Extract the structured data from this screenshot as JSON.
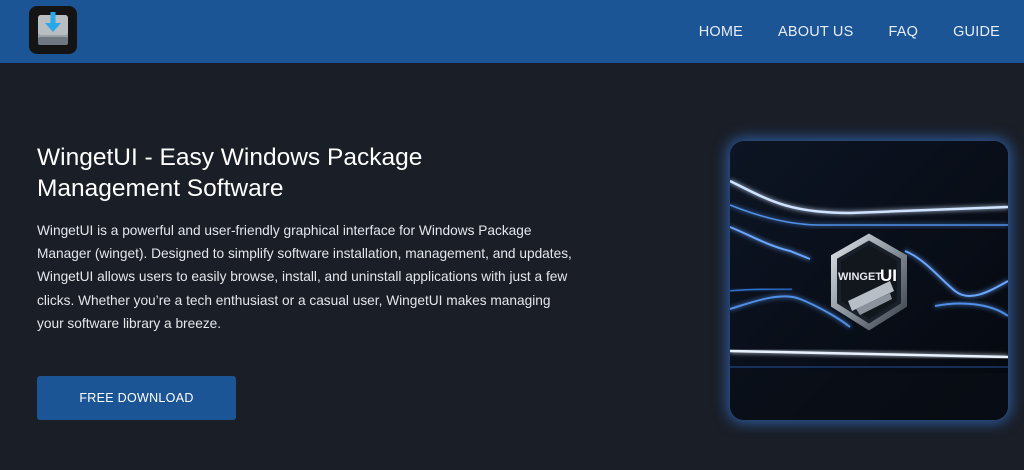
{
  "header": {
    "logo_alt": "WingetUI logo",
    "nav": [
      {
        "label": "HOME"
      },
      {
        "label": "ABOUT US"
      },
      {
        "label": "FAQ"
      },
      {
        "label": "GUIDE"
      }
    ]
  },
  "hero": {
    "title": "WingetUI - Easy Windows Package Management Software",
    "description": "WingetUI is a powerful and user-friendly graphical interface for Windows Package Manager (winget). Designed to simplify software installation, management, and updates, WingetUI allows users to easily browse, install, and uninstall applications with just a few clicks. Whether you’re a tech enthusiast or a casual user, WingetUI makes managing your software library a breeze.",
    "cta_label": "FREE DOWNLOAD",
    "image_logo_text_a": "WINGET",
    "image_logo_text_b": "UI"
  },
  "colors": {
    "header_bg": "#1c5596",
    "page_bg": "#1a1e26",
    "button_bg": "#1c5596",
    "accent_glow": "#3c8cff"
  },
  "icons": {
    "logo": "download-box-icon"
  }
}
